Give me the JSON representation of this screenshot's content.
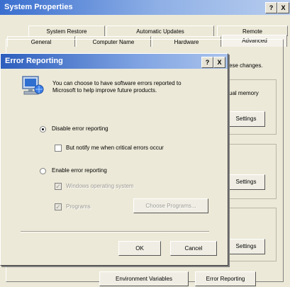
{
  "system_properties": {
    "title": "System Properties",
    "help_glyph": "?",
    "close_glyph": "X",
    "tabs_top": [
      "System Restore",
      "Automatic Updates",
      "Remote"
    ],
    "tabs_bottom": [
      "General",
      "Computer Name",
      "Hardware",
      "Advanced"
    ],
    "background_text": [
      "ese changes.",
      "ual memory"
    ],
    "settings_label": "Settings",
    "env_vars_label": "Environment Variables",
    "error_reporting_label": "Error Reporting"
  },
  "error_reporting_dialog": {
    "title": "Error Reporting",
    "help_glyph": "?",
    "close_glyph": "X",
    "info_text": "You can choose to have software errors reported to Microsoft to help improve future products.",
    "disable_label": "Disable error reporting",
    "disable_selected": true,
    "notify_label": "But notify me when critical errors occur",
    "enable_label": "Enable error reporting",
    "windows_os_label": "Windows operating system",
    "programs_label": "Programs",
    "choose_programs_label": "Choose Programs...",
    "ok_label": "OK",
    "cancel_label": "Cancel",
    "check_glyph": "✓"
  }
}
